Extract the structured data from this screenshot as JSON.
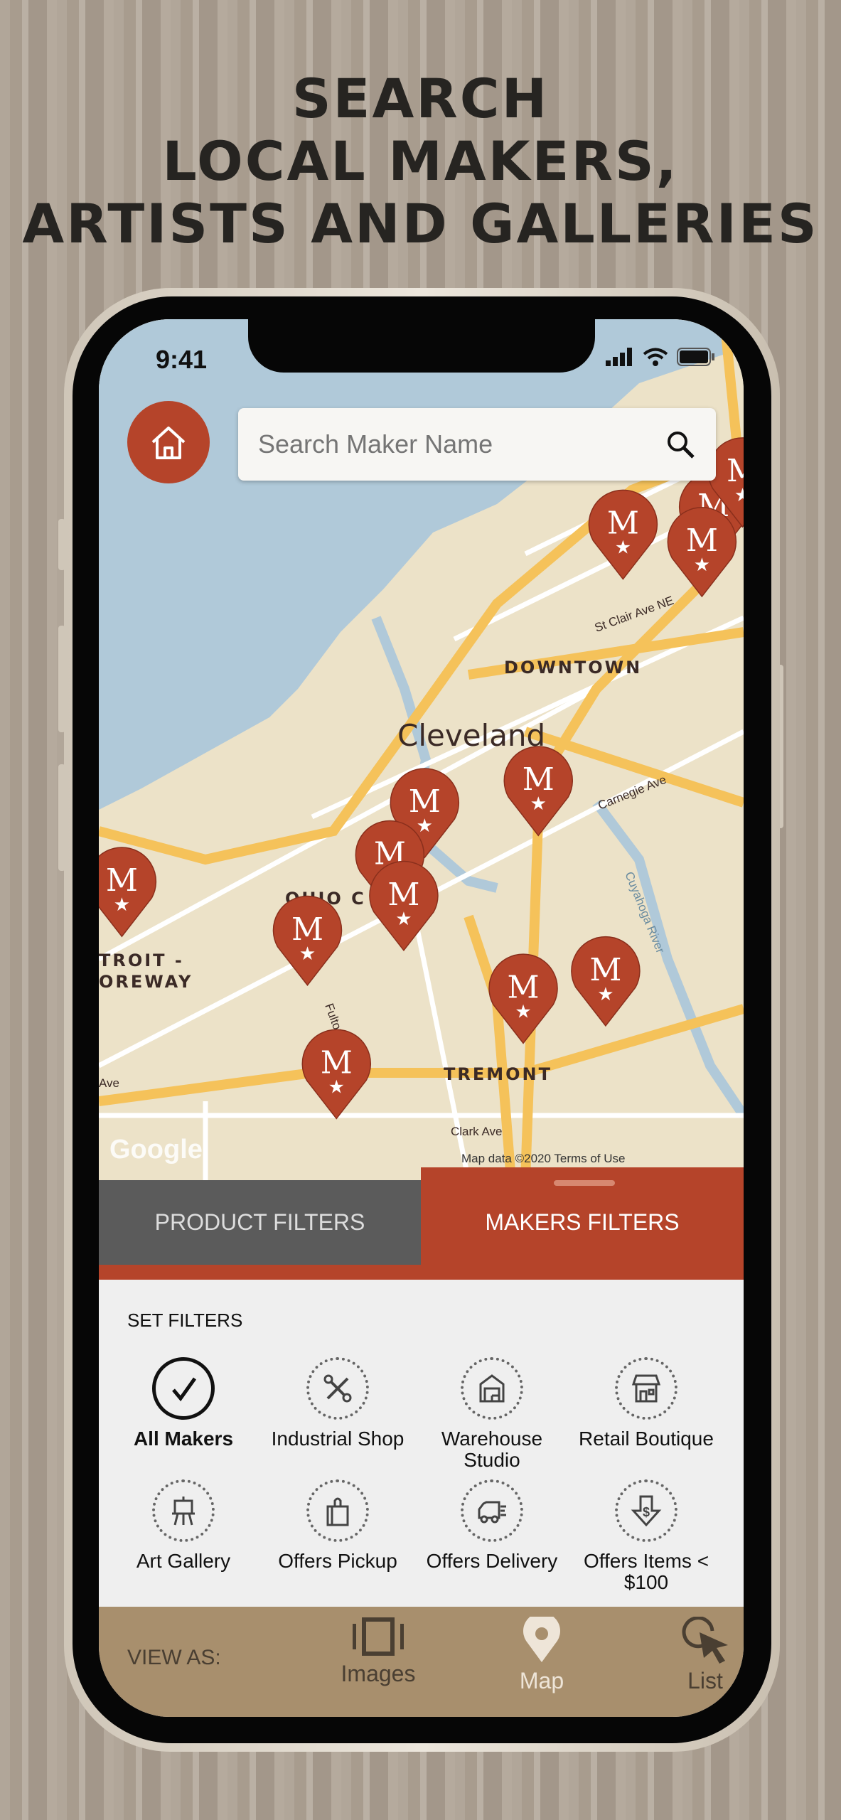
{
  "headline": [
    "SEARCH",
    "LOCAL MAKERS,",
    "ARTISTS AND GALLERIES"
  ],
  "status_bar": {
    "time": "9:41"
  },
  "search": {
    "placeholder": "Search Maker Name"
  },
  "map": {
    "labels": {
      "city": "Cleveland",
      "downtown": "DOWNTOWN",
      "ohio_city": "OHIO C",
      "detroit1": "TROIT -",
      "detroit2": "OREWAY",
      "tremont": "TREMONT",
      "st_clair": "St Clair Ave NE",
      "carnegie": "Carnegie Ave",
      "cuyahoga": "Cuyahoga River",
      "fulton": "Fulton",
      "clark": "Clark Ave",
      "ave": "Ave",
      "google": "Google",
      "attribution": "Map data ©2020    Terms of Use"
    },
    "colors": {
      "water": "#b0c9d9",
      "land": "#ece2c8",
      "highway": "#f5c25a",
      "pin": "#b5442a"
    }
  },
  "tabs": {
    "product": "PRODUCT FILTERS",
    "makers": "MAKERS FILTERS",
    "active": "makers"
  },
  "filters": {
    "heading": "SET FILTERS",
    "items": [
      {
        "label": "All Makers",
        "icon": "check-icon",
        "selected": true
      },
      {
        "label": "Industrial Shop",
        "icon": "tools-icon",
        "selected": false
      },
      {
        "label": "Warehouse Studio",
        "icon": "warehouse-icon",
        "selected": false
      },
      {
        "label": "Retail Boutique",
        "icon": "storefront-icon",
        "selected": false
      },
      {
        "label": "Art Gallery",
        "icon": "easel-icon",
        "selected": false
      },
      {
        "label": "Offers Pickup",
        "icon": "bag-icon",
        "selected": false
      },
      {
        "label": "Offers Delivery",
        "icon": "truck-icon",
        "selected": false
      },
      {
        "label": "Offers Items < $100",
        "icon": "price-tag-icon",
        "selected": false
      }
    ]
  },
  "bottom_bar": {
    "view_as": "VIEW AS:",
    "images": "Images",
    "map": "Map",
    "list": "List",
    "active": "map"
  }
}
